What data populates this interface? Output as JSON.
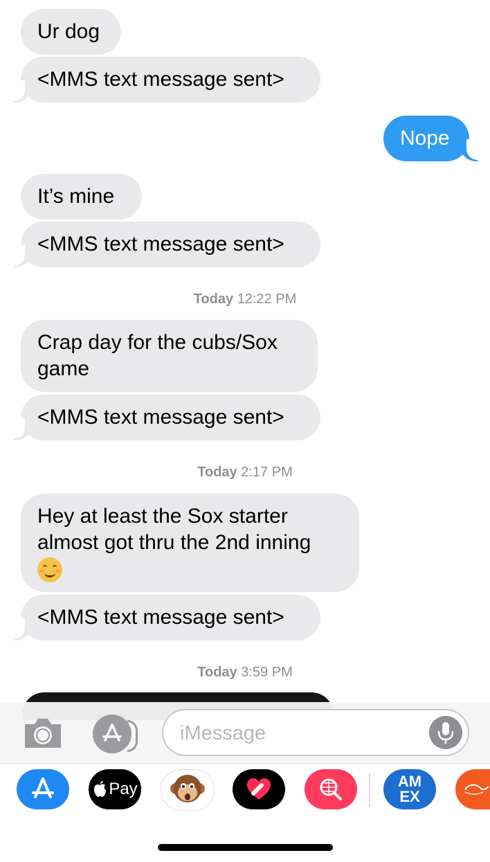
{
  "messages": [
    {
      "direction": "received",
      "text": "Ur dog"
    },
    {
      "direction": "received",
      "text": "<MMS text message sent>"
    },
    {
      "direction": "sent",
      "text": "Nope"
    },
    {
      "direction": "received",
      "text": "It’s mine"
    },
    {
      "direction": "received",
      "text": "<MMS text message sent>"
    },
    {
      "direction": "received",
      "text": "Crap day for the cubs/Sox game"
    },
    {
      "direction": "received",
      "text": "<MMS text message sent>"
    },
    {
      "direction": "received",
      "text": "Hey at least the Sox starter almost got thru the 2nd inning"
    },
    {
      "direction": "received",
      "text": "<MMS text message sent>"
    }
  ],
  "emoji": "smiling-face-with-smiling-eyes",
  "timestamps": [
    {
      "day": "Today",
      "time": "12:22 PM"
    },
    {
      "day": "Today",
      "time": "2:17 PM"
    },
    {
      "day": "Today",
      "time": "3:59 PM"
    }
  ],
  "composer": {
    "placeholder": "iMessage"
  },
  "app_drawer": {
    "apple_pay_label": "Pay",
    "amex_label_top": "AM",
    "amex_label_bottom": "EX",
    "apps": [
      "app-store",
      "apple-pay",
      "animoji",
      "digital-touch",
      "search-images",
      "american-express",
      "partial-app"
    ]
  },
  "colors": {
    "sent_bubble": "#2f9bf3",
    "received_bubble": "#e9e9eb",
    "timestamp": "#8e8e93"
  }
}
